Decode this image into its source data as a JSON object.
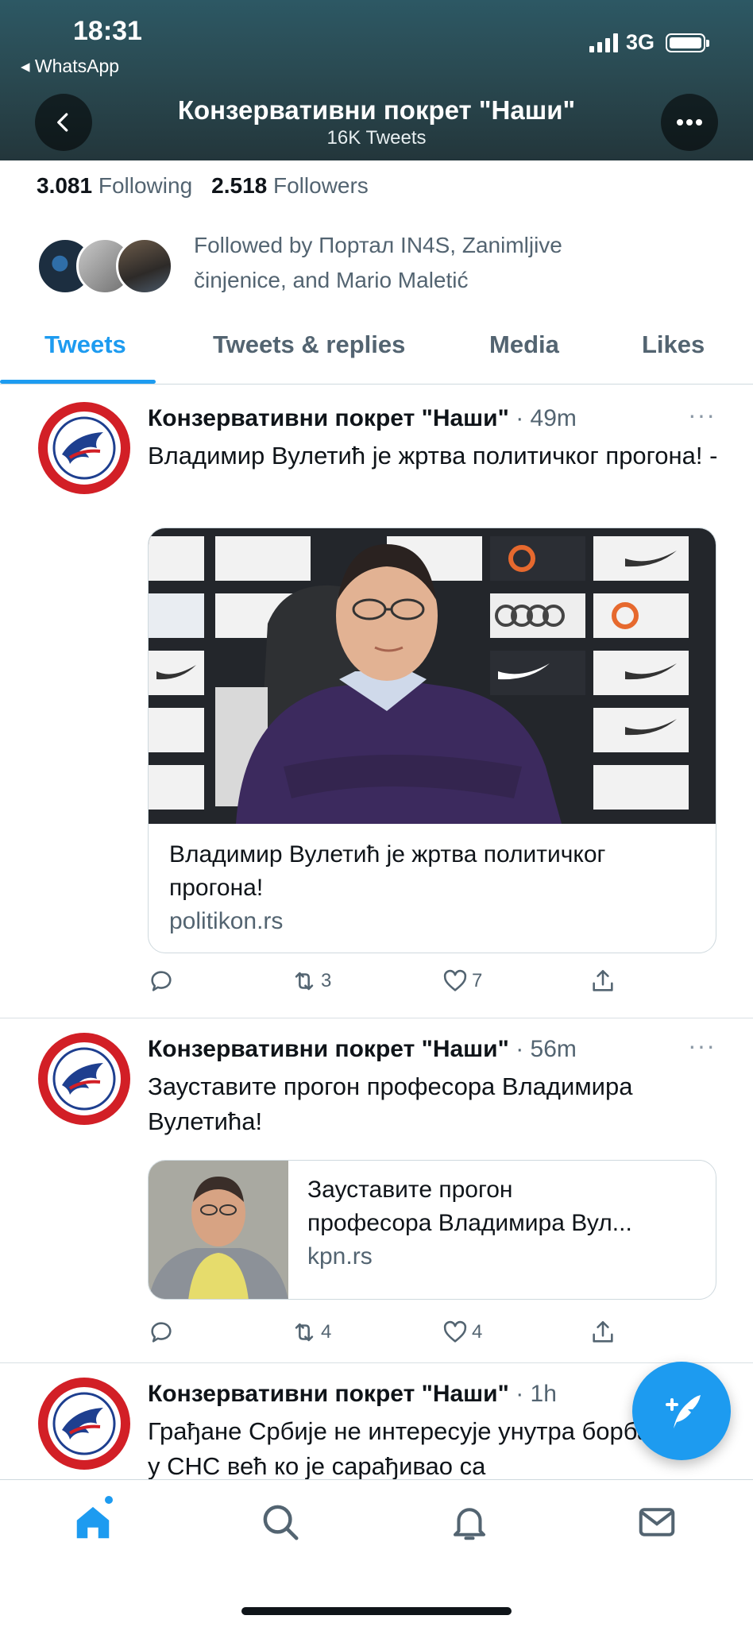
{
  "status_bar": {
    "time": "18:31",
    "back_app": "◂ WhatsApp",
    "network": "3G"
  },
  "nav": {
    "title": "Конзервативни покрет \"Наши\"",
    "subtitle": "16K Tweets"
  },
  "profile": {
    "following_count": "3.081",
    "following_label": "Following",
    "followers_count": "2.518",
    "followers_label": "Followers",
    "followed_by": "Followed by Портал IN4S, Zanimljive činjenice, and Mario Maletić"
  },
  "tabs": [
    {
      "label": "Tweets",
      "active": true
    },
    {
      "label": "Tweets & replies",
      "active": false
    },
    {
      "label": "Media",
      "active": false
    },
    {
      "label": "Likes",
      "active": false
    }
  ],
  "tweets": [
    {
      "author": "Конзервативни покрет \"Наши\"",
      "time": "· 49m",
      "text": "Владимир Вулетић је жртва политичког прогона! -",
      "card": {
        "title": "Владимир Вулетић је жртва политичког прогона!",
        "domain": "politikon.rs"
      },
      "retweets": "3",
      "likes": "7"
    },
    {
      "author": "Конзервативни покрет \"Наши\"",
      "time": "· 56m",
      "text": "Зауставите прогон професора Владимира Вулетића!",
      "card": {
        "title_line1": "Зауставите прогон",
        "title_line2": "професора Владимира Вул...",
        "domain": "kpn.rs"
      },
      "retweets": "4",
      "likes": "4"
    },
    {
      "author": "Конзервативни покрет \"Наши\"",
      "time": "· 1h",
      "text": "Грађане Србије не интересује унутра борба у СНС већ ко је сарађивао са"
    }
  ],
  "icons": {
    "reply": "reply-icon",
    "retweet": "retweet-icon",
    "like": "heart-icon",
    "share": "share-icon",
    "compose": "compose-tweet-icon",
    "home": "home-icon",
    "search": "search-icon",
    "notifications": "bell-icon",
    "messages": "mail-icon"
  },
  "colors": {
    "accent": "#1d9bf0",
    "header_bg": "#2a4a52",
    "text_secondary": "#536471"
  }
}
